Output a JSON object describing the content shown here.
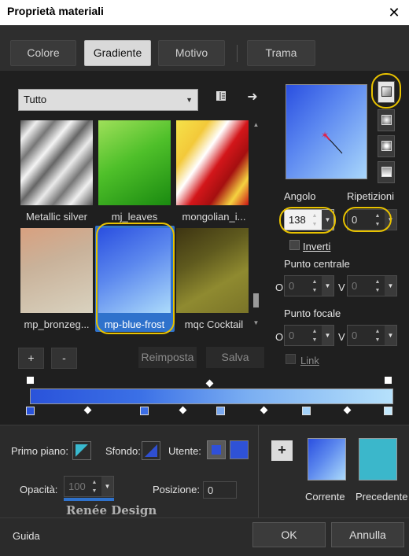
{
  "window": {
    "title": "Proprietà materiali",
    "close_label": "✕"
  },
  "tabs": [
    {
      "label": "Colore"
    },
    {
      "label": "Gradiente"
    },
    {
      "label": "Motivo"
    },
    {
      "label": "Trama"
    }
  ],
  "active_tab": "Gradiente",
  "category_dropdown": {
    "value": "Tutto"
  },
  "gradients": [
    {
      "label": "Metallic silver"
    },
    {
      "label": "mj_leaves"
    },
    {
      "label": "mongolian_i..."
    },
    {
      "label": "mp_bronzeg..."
    },
    {
      "label": "mp-blue-frost"
    },
    {
      "label": "mqc Cocktail"
    }
  ],
  "selected_gradient": "mp-blue-frost",
  "buttons": {
    "add": "+",
    "remove": "-",
    "reset": "Reimposta",
    "save": "Salva"
  },
  "settings": {
    "angle_label": "Angolo",
    "angle_value": "138",
    "repeats_label": "Ripetizioni",
    "repeats_value": "0",
    "invert_label": "Inverti",
    "center_point_label": "Punto centrale",
    "center_o_label": "O",
    "center_o_value": "0",
    "center_v_label": "V",
    "center_v_value": "0",
    "focal_point_label": "Punto focale",
    "focal_o_label": "O",
    "focal_o_value": "0",
    "focal_v_label": "V",
    "focal_v_value": "0",
    "link_label": "Link"
  },
  "bottom": {
    "foreground_label": "Primo piano:",
    "background_label": "Sfondo:",
    "user_label": "Utente:",
    "opacity_label": "Opacità:",
    "opacity_value": "100",
    "position_label": "Posizione:",
    "position_value": "0",
    "current_label": "Corrente",
    "previous_label": "Precedente",
    "add_symbol": "+"
  },
  "watermark": "Renée Design",
  "footer": {
    "help": "Guida",
    "ok": "OK",
    "cancel": "Annulla"
  },
  "colors": {
    "gradient_start": "#2a53da",
    "gradient_end": "#b6e1fb",
    "previous_swatch": "#3bb7cb",
    "highlight_ring": "#e8c200",
    "selection": "#2f72cc"
  }
}
